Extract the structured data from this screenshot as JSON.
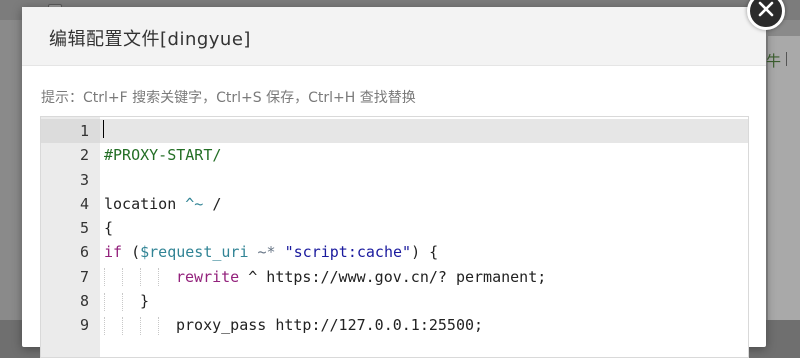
{
  "dialog": {
    "title": "编辑配置文件[dingyue]",
    "hint": "提示：Ctrl+F 搜索关键字，Ctrl+S 保存，Ctrl+H 查找替换"
  },
  "close_icon": "close-icon",
  "background": {
    "partial_text": "牛"
  },
  "editor": {
    "line_numbers": [
      "1",
      "2",
      "3",
      "4",
      "5",
      "6",
      "7",
      "8",
      "9"
    ],
    "lines": [
      {
        "tokens": []
      },
      {
        "tokens": [
          {
            "t": "#PROXY-START/",
            "c": "comment"
          }
        ]
      },
      {
        "tokens": []
      },
      {
        "tokens": [
          {
            "t": "location ",
            "c": "plain"
          },
          {
            "t": "^~",
            "c": "var"
          },
          {
            "t": " /",
            "c": "plain"
          }
        ]
      },
      {
        "tokens": [
          {
            "t": "{",
            "c": "plain"
          }
        ]
      },
      {
        "tokens": [
          {
            "t": "if",
            "c": "keyword"
          },
          {
            "t": " (",
            "c": "plain"
          },
          {
            "t": "$request_uri",
            "c": "var"
          },
          {
            "t": " ",
            "c": "plain"
          },
          {
            "t": "~*",
            "c": "op"
          },
          {
            "t": " ",
            "c": "plain"
          },
          {
            "t": "\"script:cache\"",
            "c": "string"
          },
          {
            "t": ") {",
            "c": "plain"
          }
        ]
      },
      {
        "indent": 4,
        "tokens": [
          {
            "t": "rewrite",
            "c": "keyword"
          },
          {
            "t": " ^ https://www.gov.cn/? permanent;",
            "c": "plain"
          }
        ]
      },
      {
        "indent": 2,
        "tokens": [
          {
            "t": "}",
            "c": "plain"
          }
        ]
      },
      {
        "indent": 4,
        "tokens": [
          {
            "t": "proxy_pass http://127.0.0.1:25500;",
            "c": "plain"
          }
        ]
      }
    ]
  },
  "colors": {
    "comment": "#236e25",
    "keyword": "#93227c",
    "var": "#318495",
    "string": "#1a1a9e",
    "op": "#687687",
    "overlay": "#8a8a8a"
  }
}
